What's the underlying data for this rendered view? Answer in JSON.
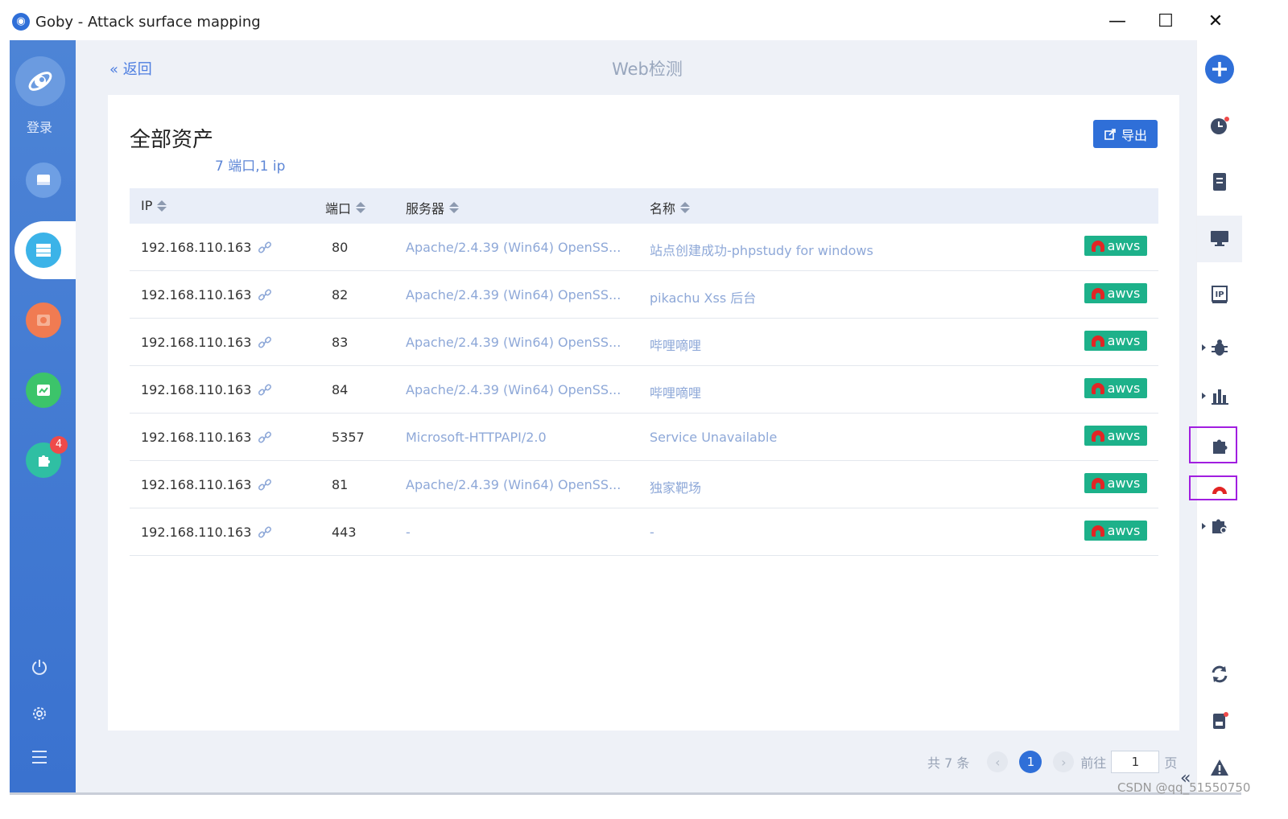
{
  "window": {
    "title": "Goby - Attack surface mapping",
    "minimize": "—",
    "maximize": "☐",
    "close": "✕"
  },
  "sidebar": {
    "login_label": "登录",
    "plugin_badge": "4"
  },
  "header": {
    "back_label": "« 返回",
    "title": "Web检测"
  },
  "card": {
    "title": "全部资产",
    "subtitle": "7 端口,1 ip",
    "export_label": "导出"
  },
  "table": {
    "columns": [
      "IP",
      "端口",
      "服务器",
      "名称"
    ],
    "tag_label": "awvs",
    "rows": [
      {
        "ip": "192.168.110.163",
        "port": "80",
        "server": "Apache/2.4.39 (Win64) OpenSS...",
        "name": "站点创建成功-phpstudy for windows"
      },
      {
        "ip": "192.168.110.163",
        "port": "82",
        "server": "Apache/2.4.39 (Win64) OpenSS...",
        "name": "pikachu Xss 后台"
      },
      {
        "ip": "192.168.110.163",
        "port": "83",
        "server": "Apache/2.4.39 (Win64) OpenSS...",
        "name": "哔哩嘀哩"
      },
      {
        "ip": "192.168.110.163",
        "port": "84",
        "server": "Apache/2.4.39 (Win64) OpenSS...",
        "name": "哔哩嘀哩"
      },
      {
        "ip": "192.168.110.163",
        "port": "5357",
        "server": "Microsoft-HTTPAPI/2.0",
        "name": "Service Unavailable"
      },
      {
        "ip": "192.168.110.163",
        "port": "81",
        "server": "Apache/2.4.39 (Win64) OpenSS...",
        "name": "独家靶场"
      },
      {
        "ip": "192.168.110.163",
        "port": "443",
        "server": "-",
        "name": "-"
      }
    ]
  },
  "pagination": {
    "total": "共 7 条",
    "current_page": "1",
    "goto_label": "前往",
    "goto_value": "1",
    "page_suffix": "页"
  },
  "watermark": "CSDN @qq_51550750",
  "colors": {
    "sidebar": "#3a72cf",
    "accent": "#2f6fd8",
    "tag": "#1db18a",
    "highlight": "#a11ee0"
  }
}
